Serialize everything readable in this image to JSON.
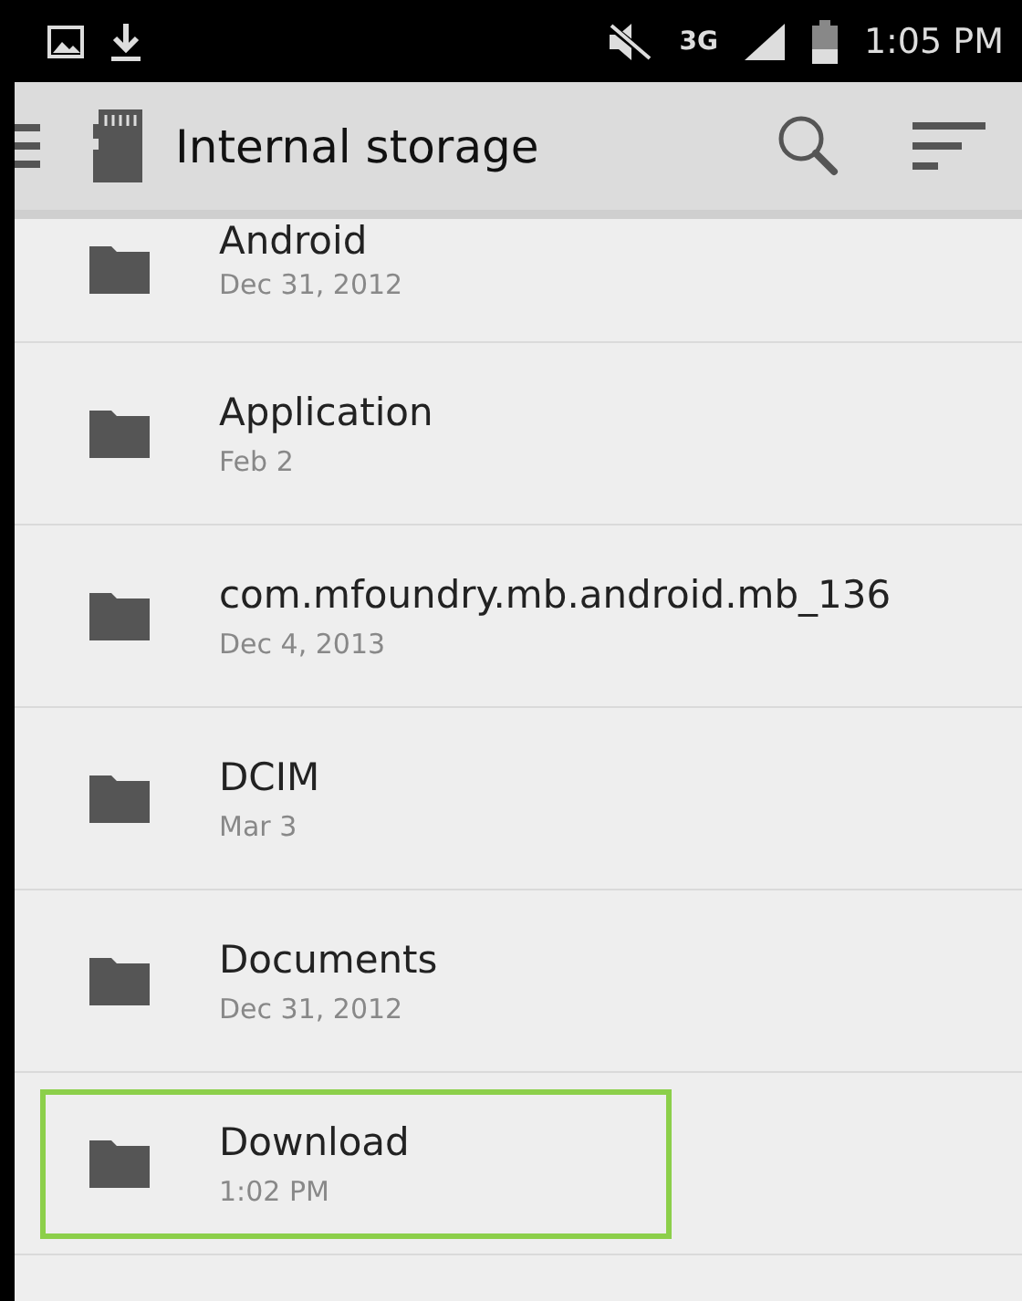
{
  "status_bar": {
    "time": "1:05 PM",
    "network": "3G"
  },
  "toolbar": {
    "title": "Internal storage"
  },
  "files": [
    {
      "name": "Android",
      "date": "Dec 31, 2012",
      "selected": false
    },
    {
      "name": "Application",
      "date": "Feb 2",
      "selected": false
    },
    {
      "name": "com.mfoundry.mb.android.mb_136",
      "date": "Dec 4, 2013",
      "selected": false
    },
    {
      "name": "DCIM",
      "date": "Mar 3",
      "selected": false
    },
    {
      "name": "Documents",
      "date": "Dec 31, 2012",
      "selected": false
    },
    {
      "name": "Download",
      "date": "1:02 PM",
      "selected": true
    }
  ]
}
